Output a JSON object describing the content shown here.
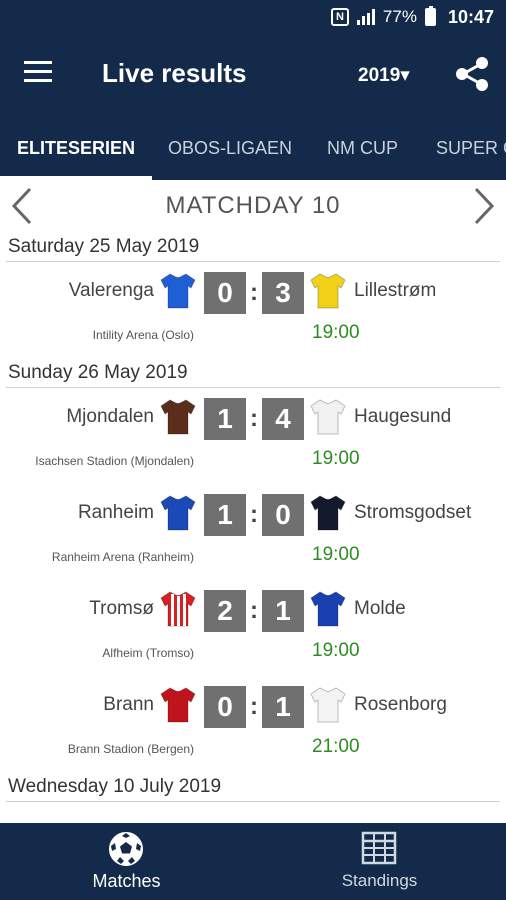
{
  "status_bar": {
    "battery": "77%",
    "time": "10:47"
  },
  "app_bar": {
    "title": "Live results",
    "year": "2019▾",
    "menu_icon": "hamburger-menu-icon",
    "share_icon": "share-icon"
  },
  "tabs": [
    {
      "label": "ELITESERIEN",
      "active": true
    },
    {
      "label": "OBOS-LIGAEN",
      "active": false
    },
    {
      "label": "NM CUP",
      "active": false
    },
    {
      "label": "SUPER CUP",
      "active": false
    }
  ],
  "matchday": {
    "title": "MATCHDAY 10"
  },
  "days": [
    {
      "date": "Saturday 25 May 2019",
      "matches": [
        {
          "home": "Valerenga",
          "away": "Lillestrøm",
          "home_score": "0",
          "away_score": "3",
          "venue": "Intility Arena (Oslo)",
          "time": "19:00",
          "home_kit": "#1f5fd6",
          "away_kit": "#f2d219"
        }
      ]
    },
    {
      "date": "Sunday 26 May 2019",
      "matches": [
        {
          "home": "Mjondalen",
          "away": "Haugesund",
          "home_score": "1",
          "away_score": "4",
          "venue": "Isachsen Stadion (Mjondalen)",
          "time": "19:00",
          "home_kit": "#5a2e1a",
          "away_kit": "#f2f2f2"
        },
        {
          "home": "Ranheim",
          "away": "Stromsgodset",
          "home_score": "1",
          "away_score": "0",
          "venue": "Ranheim Arena (Ranheim)",
          "time": "19:00",
          "home_kit": "#1a49b8",
          "away_kit": "#141a2e"
        },
        {
          "home": "Tromsø",
          "away": "Molde",
          "home_score": "2",
          "away_score": "1",
          "venue": "Alfheim (Tromso)",
          "time": "19:00",
          "home_kit": "#d92020",
          "away_kit": "#1a3fb0"
        },
        {
          "home": "Brann",
          "away": "Rosenborg",
          "home_score": "0",
          "away_score": "1",
          "venue": "Brann Stadion (Bergen)",
          "time": "21:00",
          "home_kit": "#c0141c",
          "away_kit": "#f4f4f4"
        }
      ]
    },
    {
      "date": "Wednesday 10 July 2019",
      "matches": []
    }
  ],
  "bottom_nav": [
    {
      "label": "Matches",
      "icon": "soccer-ball-icon",
      "active": true
    },
    {
      "label": "Standings",
      "icon": "table-grid-icon",
      "active": false
    }
  ],
  "colors": {
    "primary": "#132a4a",
    "score_box": "#707070",
    "kickoff": "#2e8b22"
  }
}
